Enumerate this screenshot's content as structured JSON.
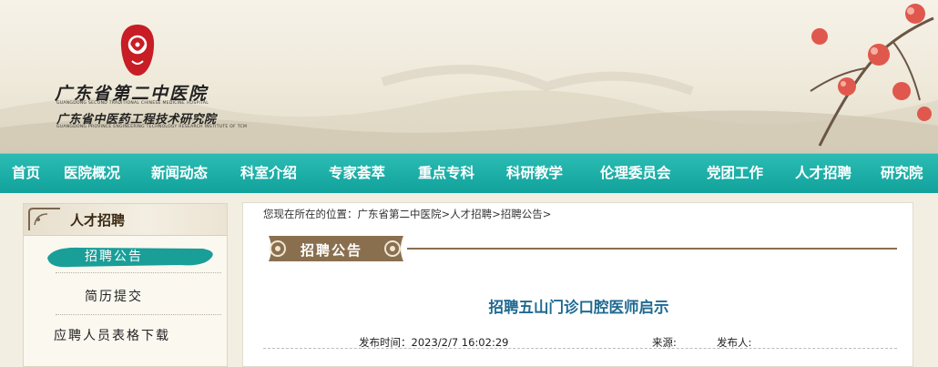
{
  "header": {
    "hospital_name_cn": "广东省第二中医院",
    "hospital_name_en": "GUANGDONG SECOND TRADITIONAL CHINESE MEDICINE HOSPITAL",
    "institute_name_cn": "广东省中医药工程技术研究院",
    "institute_name_en": "GUANGDONG PROVINCE ENGINEERING TECHNOLOGY RESEARCH INSTITUTE OF TCM"
  },
  "nav": {
    "items": [
      "首页",
      "医院概况",
      "新闻动态",
      "科室介绍",
      "专家荟萃",
      "重点专科",
      "科研教学",
      "伦理委员会",
      "党团工作",
      "人才招聘",
      "研究院"
    ]
  },
  "sidebar": {
    "title": "人才招聘",
    "items": [
      "招聘公告",
      "简历提交",
      "应聘人员表格下载"
    ],
    "active_index": 0
  },
  "main": {
    "breadcrumb_prefix": "您现在所在的位置：",
    "breadcrumb": [
      "广东省第二中医院",
      "人才招聘",
      "招聘公告"
    ],
    "breadcrumb_sep": ">",
    "section_title": "招聘公告",
    "article_title": "招聘五山门诊口腔医师启示",
    "publish_label": "发布时间：",
    "publish_time": "2023/2/7 16:02:29",
    "source_label": "来源:",
    "publisher_label": "发布人:"
  },
  "colors": {
    "nav_bg": "#13a59e",
    "accent_teal": "#1a9e98",
    "article_title": "#1f6a91",
    "seal_red": "#c81d25",
    "banner_brown": "#8a6f4f"
  }
}
